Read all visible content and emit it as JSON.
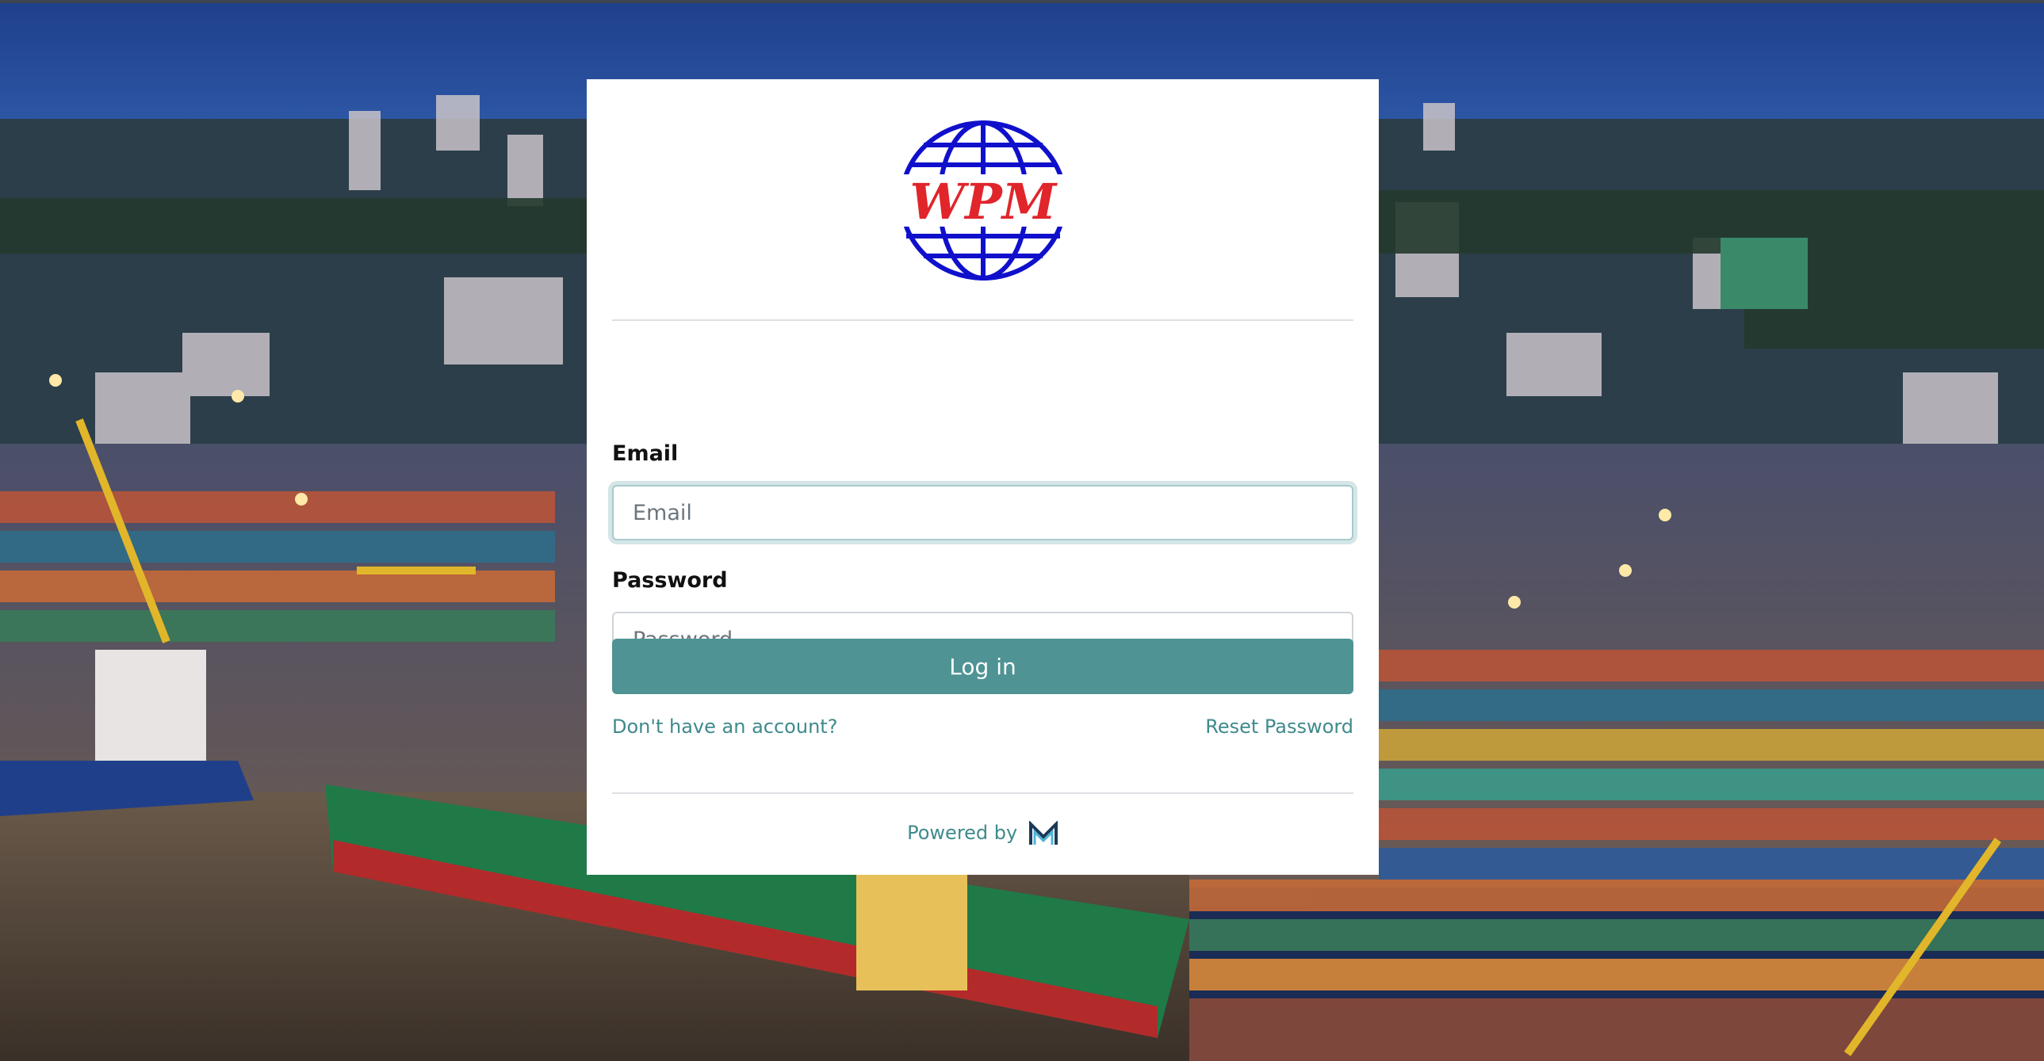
{
  "brand": {
    "logo_text": "WPM",
    "logo_colors": {
      "globe": "#1010cc",
      "letters": "#e0252b"
    }
  },
  "form": {
    "email_label": "Email",
    "email_placeholder": "Email",
    "email_value": "",
    "password_label": "Password",
    "password_placeholder": "Password",
    "password_value": "",
    "login_button": "Log in",
    "signup_link": "Don't have an account?",
    "reset_link": "Reset Password"
  },
  "footer": {
    "powered_by": "Powered by",
    "powered_logo": "M"
  },
  "colors": {
    "accent": "#4f9394",
    "link": "#3f8a8c",
    "focus_ring": "#d4e6e7"
  }
}
